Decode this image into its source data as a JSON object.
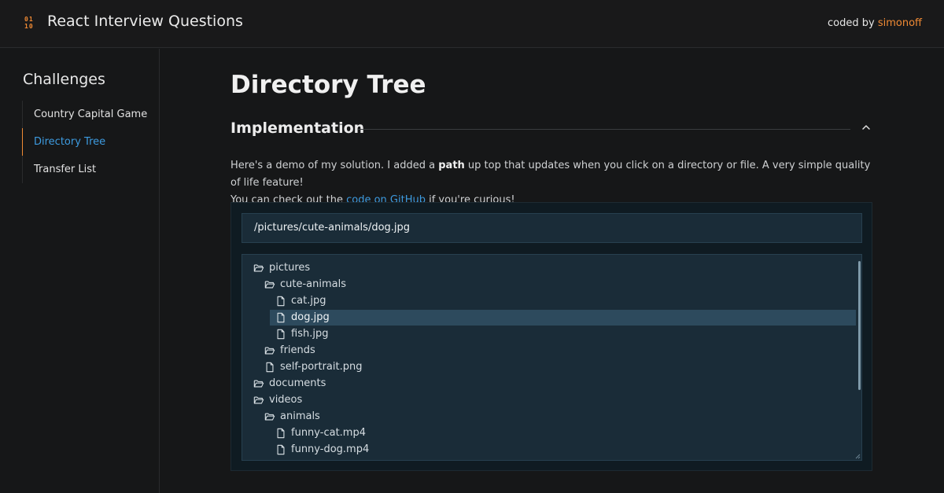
{
  "header": {
    "logo_text": "01\n10",
    "title": "React Interview Questions",
    "credit_prefix": "coded by ",
    "credit_author": "simonoff",
    "accent_color": "#f08a34"
  },
  "sidebar": {
    "title": "Challenges",
    "items": [
      {
        "label": "Country Capital Game",
        "active": false
      },
      {
        "label": "Directory Tree",
        "active": true
      },
      {
        "label": "Transfer List",
        "active": false
      }
    ]
  },
  "main": {
    "page_title": "Directory Tree",
    "section_title": "Implementation",
    "intro_1": "Here's a demo of my solution. I added a ",
    "intro_bold": "path",
    "intro_2": " up top that updates when you click on a directory or file. A very simple quality of life feature!",
    "intro_3": "You can check out the ",
    "intro_link": "code on GitHub",
    "intro_4": " if you're curious!",
    "link_color": "#3d9be0"
  },
  "demo": {
    "path": "/pictures/cute-animals/dog.jpg",
    "tree": [
      {
        "name": "pictures",
        "type": "folder",
        "depth": 0
      },
      {
        "name": "cute-animals",
        "type": "folder",
        "depth": 1
      },
      {
        "name": "cat.jpg",
        "type": "file",
        "depth": 2
      },
      {
        "name": "dog.jpg",
        "type": "file",
        "depth": 2,
        "selected": true
      },
      {
        "name": "fish.jpg",
        "type": "file",
        "depth": 2
      },
      {
        "name": "friends",
        "type": "folder",
        "depth": 1
      },
      {
        "name": "self-portrait.png",
        "type": "file",
        "depth": 1
      },
      {
        "name": "documents",
        "type": "folder",
        "depth": 0
      },
      {
        "name": "videos",
        "type": "folder",
        "depth": 0
      },
      {
        "name": "animals",
        "type": "folder",
        "depth": 1
      },
      {
        "name": "funny-cat.mp4",
        "type": "file",
        "depth": 2
      },
      {
        "name": "funny-dog.mp4",
        "type": "file",
        "depth": 2
      }
    ],
    "icons": {
      "folder": "folder-open-icon",
      "file": "file-icon"
    }
  }
}
